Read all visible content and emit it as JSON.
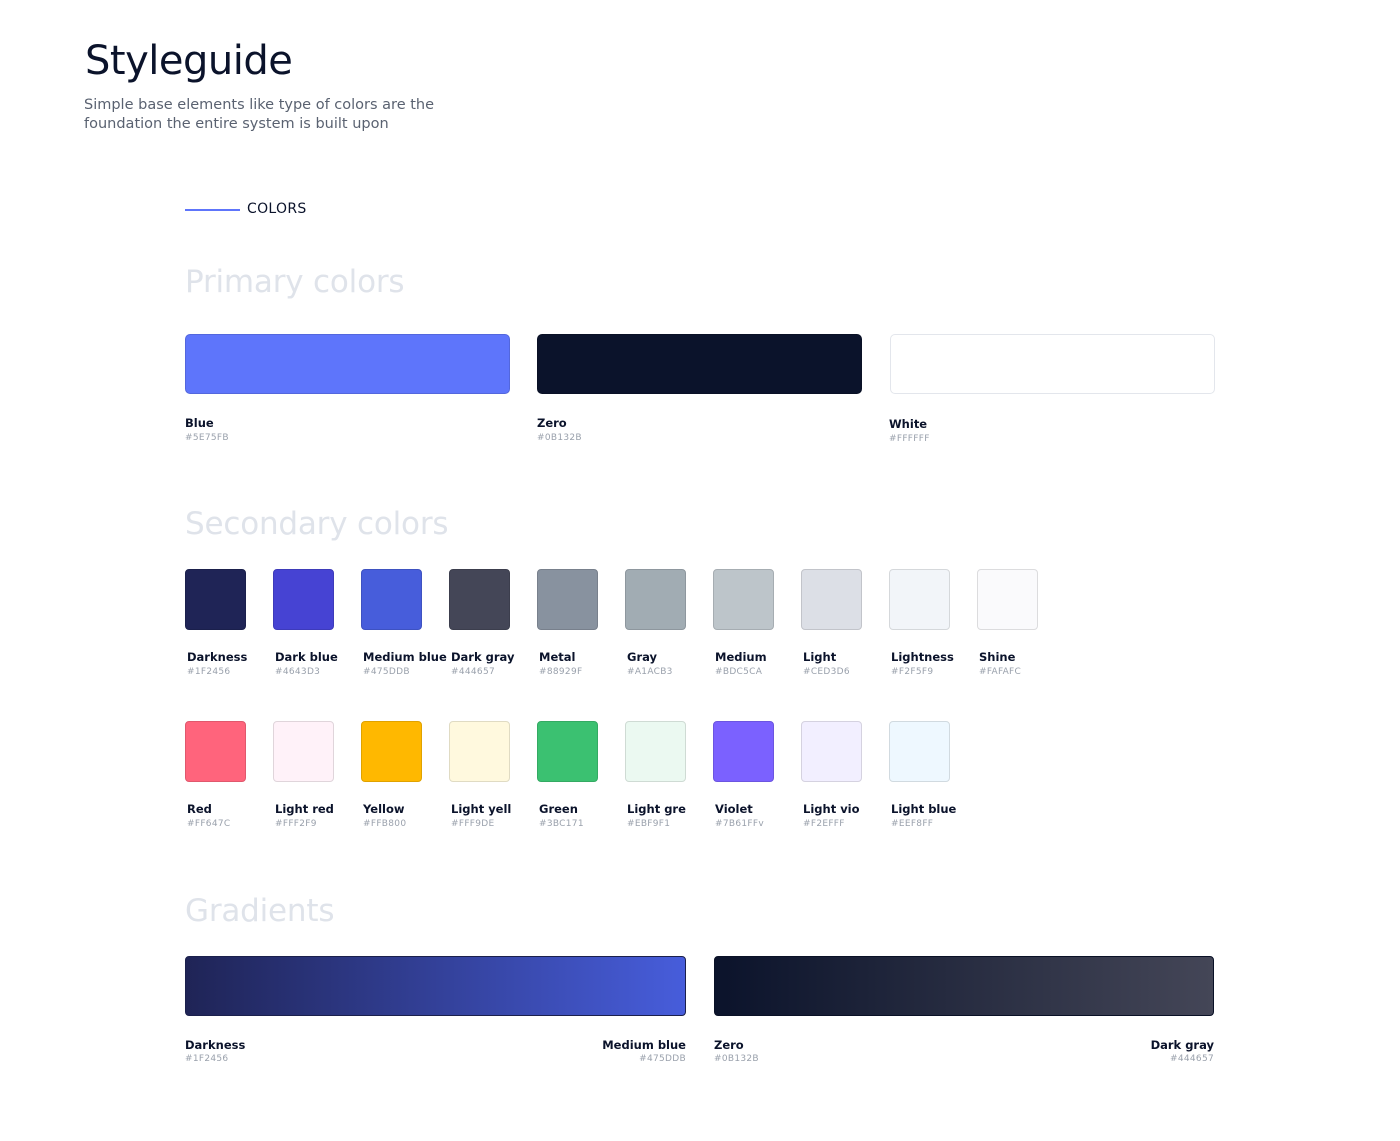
{
  "header": {
    "title": "Styleguide",
    "subtitle": "Simple base elements like type of colors are the foundation the entire system is built upon"
  },
  "section": {
    "label": "COLORS"
  },
  "primary": {
    "title": "Primary colors",
    "colors": [
      {
        "name": "Blue",
        "hex": "#5E75FB",
        "color": "#5E75FB"
      },
      {
        "name": "Zero",
        "hex": "#0B132B",
        "color": "#0B132B"
      },
      {
        "name": "White",
        "hex": "#FFFFFF",
        "color": "#FFFFFF"
      }
    ]
  },
  "secondary": {
    "title": "Secondary colors",
    "row1": [
      {
        "name": "Darkness",
        "hex": "#1F2456",
        "color": "#1F2456"
      },
      {
        "name": "Dark blue",
        "hex": "#4643D3",
        "color": "#4643D3"
      },
      {
        "name": "Medium blue",
        "hex": "#475DDB",
        "color": "#475DDB"
      },
      {
        "name": "Dark gray",
        "hex": "#444657",
        "color": "#444657"
      },
      {
        "name": "Metal",
        "hex": "#88929F",
        "color": "#88929F"
      },
      {
        "name": "Gray",
        "hex": "#A1ACB3",
        "color": "#A1ACB3"
      },
      {
        "name": "Medium",
        "hex": "#BDC5CA",
        "color": "#BDC5CA"
      },
      {
        "name": "Light",
        "hex": "#CED3D6",
        "color": "#DCDFE6"
      },
      {
        "name": "Lightness",
        "hex": "#F2F5F9",
        "color": "#F2F5F9"
      },
      {
        "name": "Shine",
        "hex": "#FAFAFC",
        "color": "#FAFAFC"
      }
    ],
    "row2": [
      {
        "name": "Red",
        "hex": "#FF647C",
        "color": "#FF647C"
      },
      {
        "name": "Light red",
        "hex": "#FFF2F9",
        "color": "#FFF2F9"
      },
      {
        "name": "Yellow",
        "hex": "#FFB800",
        "color": "#FFB800"
      },
      {
        "name": "Light yell",
        "hex": "#FFF9DE",
        "color": "#FFF9DE"
      },
      {
        "name": "Green",
        "hex": "#3BC171",
        "color": "#3BC171"
      },
      {
        "name": "Light gre",
        "hex": "#EBF9F1",
        "color": "#EBF9F1"
      },
      {
        "name": "Violet",
        "hex": "#7B61FFv",
        "color": "#7B61FF"
      },
      {
        "name": "Light vio",
        "hex": "#F2EFFF",
        "color": "#F2EFFF"
      },
      {
        "name": "Light blue",
        "hex": "#EEF8FF",
        "color": "#EEF8FF"
      }
    ]
  },
  "gradients": {
    "title": "Gradients",
    "items": [
      {
        "start": {
          "name": "Darkness",
          "hex": "#1F2456",
          "color": "#1F2456"
        },
        "end": {
          "name": "Medium blue",
          "hex": "#475DDB",
          "color": "#475DDB"
        }
      },
      {
        "start": {
          "name": "Zero",
          "hex": "#0B132B",
          "color": "#0B132B"
        },
        "end": {
          "name": "Dark gray",
          "hex": "#444657",
          "color": "#444657"
        }
      }
    ]
  }
}
